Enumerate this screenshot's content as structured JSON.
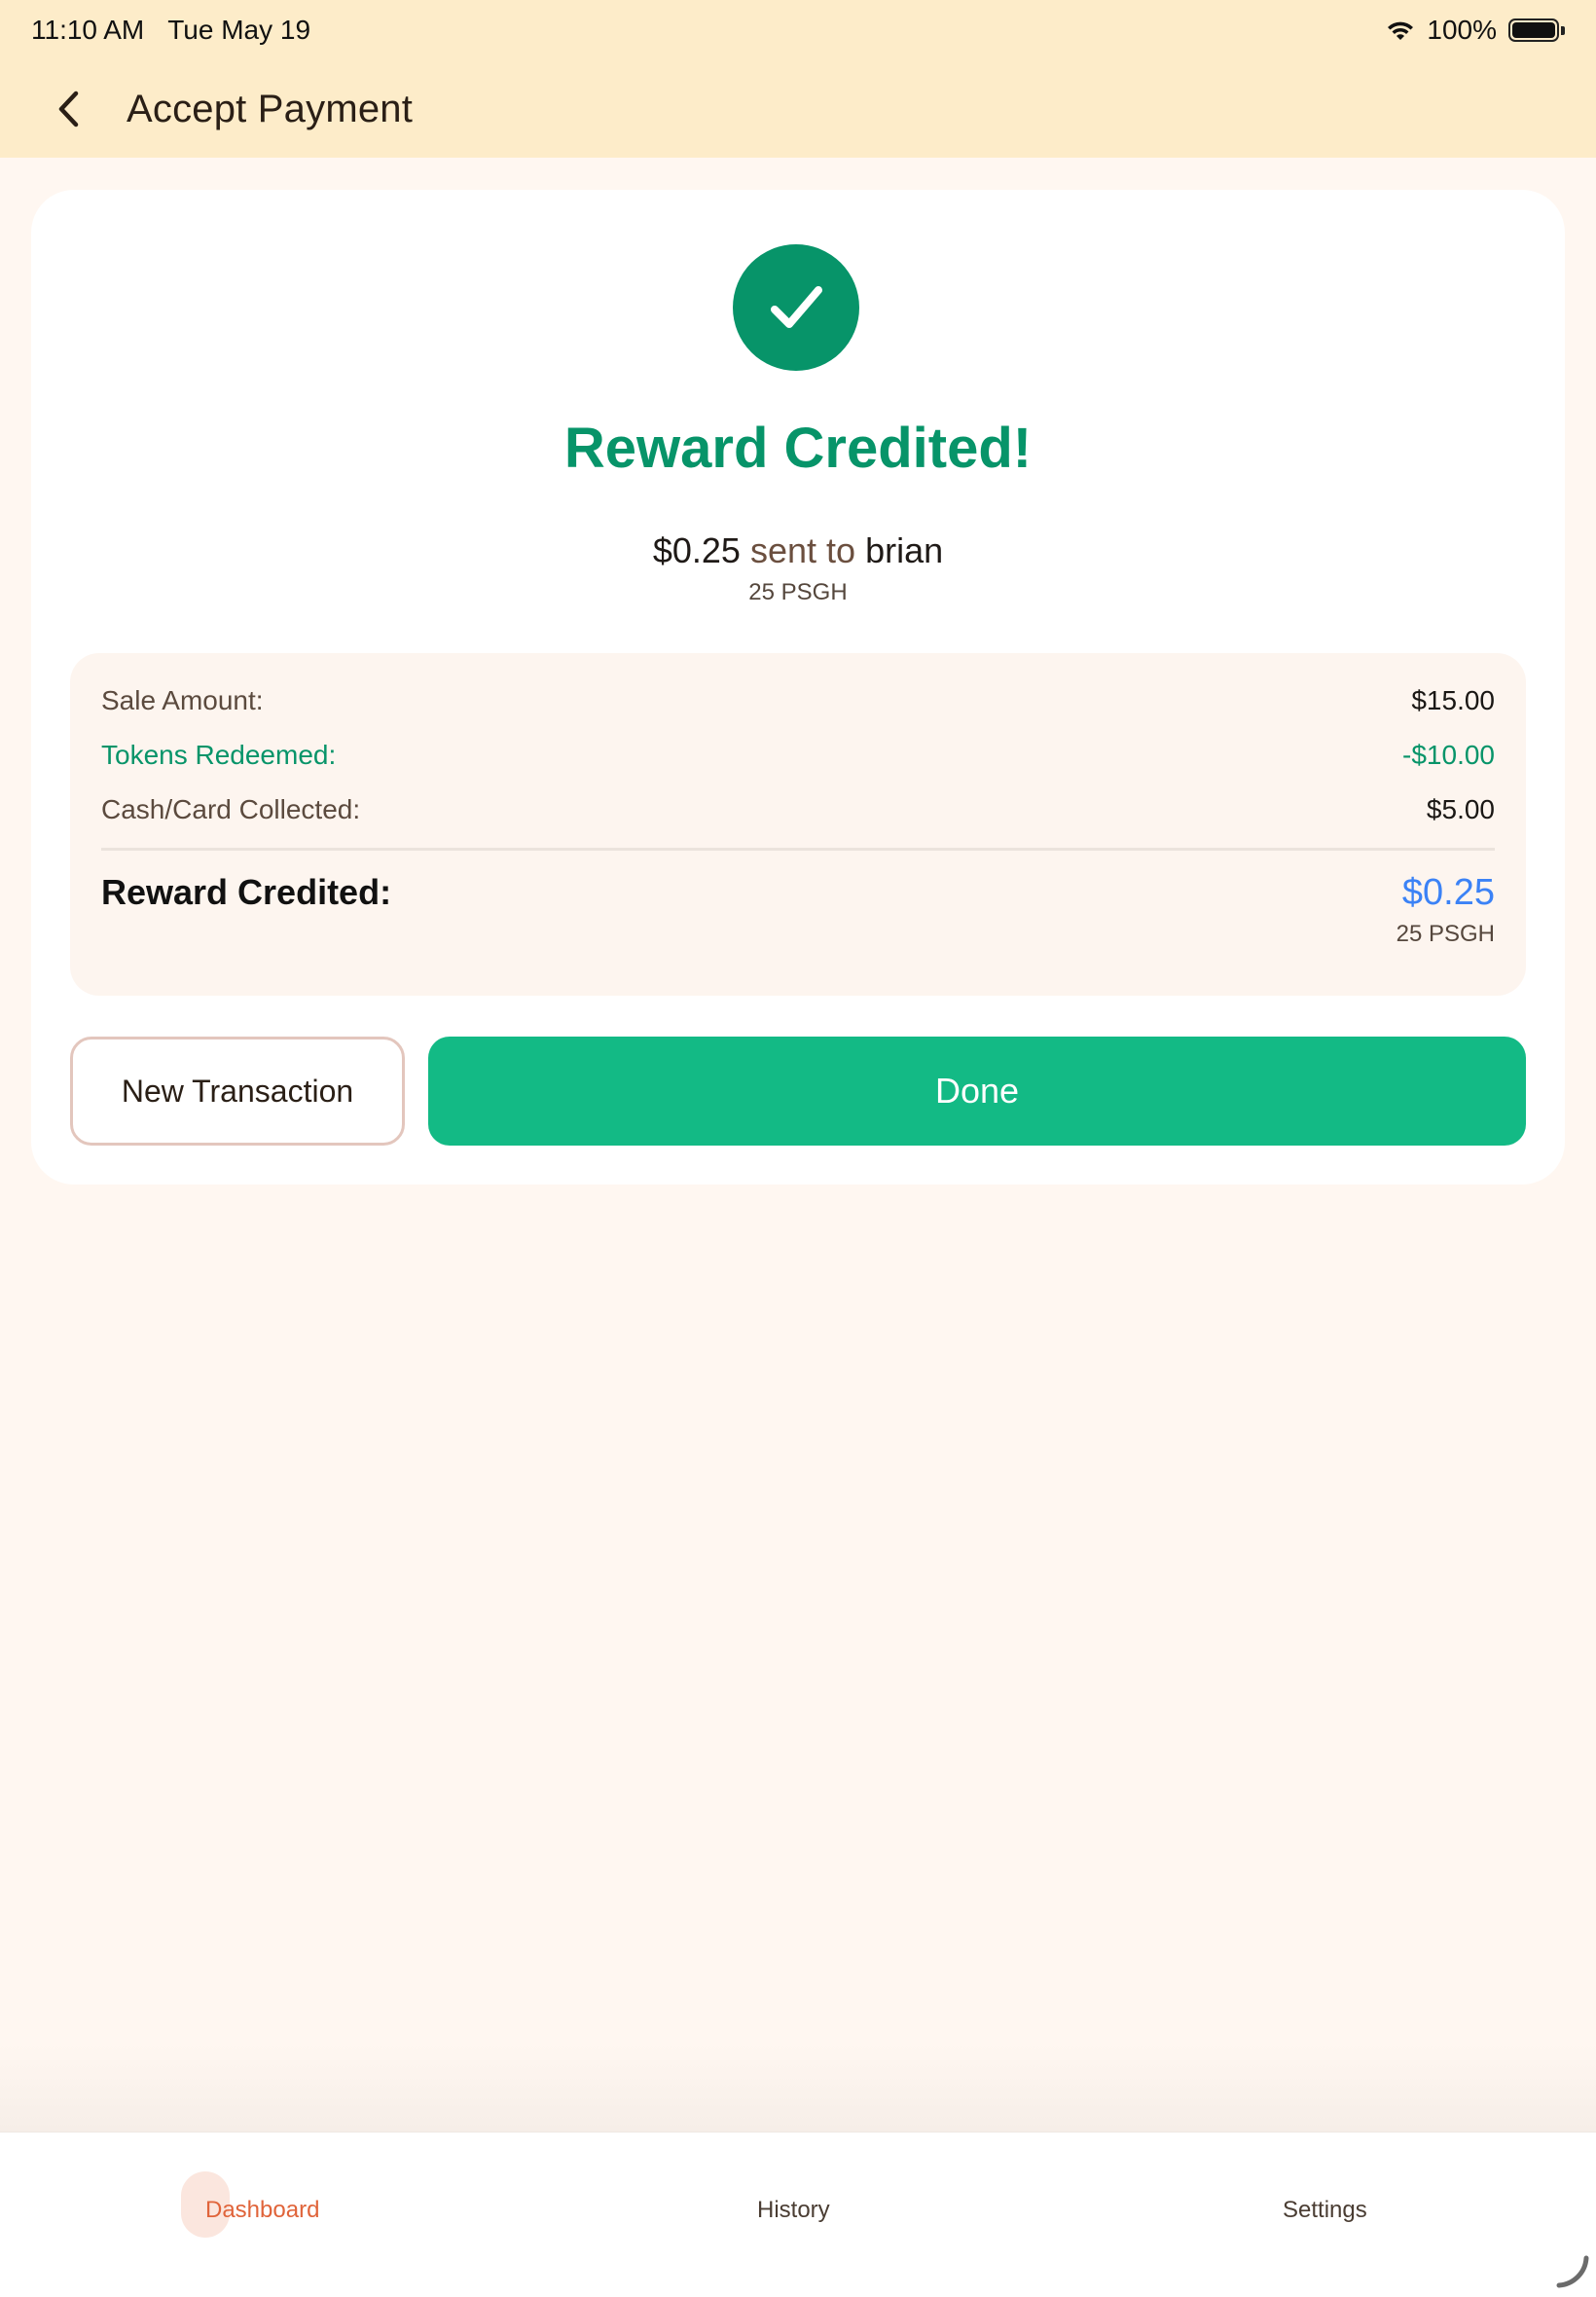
{
  "status_bar": {
    "time": "11:10 AM",
    "date": "Tue May 19",
    "battery": "100%",
    "icons": [
      "wifi-icon",
      "battery-icon"
    ]
  },
  "nav": {
    "title": "Accept Payment",
    "back_icon": "chevron-left-icon"
  },
  "result": {
    "icon": "checkmark-icon",
    "headline": "Reward Credited!",
    "amount": "$0.25",
    "sent_word": "sent to",
    "recipient": "brian",
    "tokens": "25 PSGH"
  },
  "summary": {
    "rows": [
      {
        "label": "Sale Amount:",
        "value": "$15.00"
      },
      {
        "label": "Tokens Redeemed:",
        "value": "-$10.00"
      },
      {
        "label": "Cash/Card Collected:",
        "value": "$5.00"
      }
    ],
    "reward_label": "Reward Credited:",
    "reward_value": "$0.25",
    "reward_tokens": "25 PSGH"
  },
  "buttons": {
    "new_transaction": "New Transaction",
    "done": "Done"
  },
  "tabs": [
    {
      "label": "Dashboard",
      "active": true
    },
    {
      "label": "History",
      "active": false
    },
    {
      "label": "Settings",
      "active": false
    }
  ],
  "colors": {
    "header_bg": "#fdecc9",
    "page_bg": "#fff7f1",
    "success_green": "#079469",
    "primary_button": "#13ba85",
    "reward_blue": "#3b82f6",
    "active_tab": "#e0643a"
  }
}
